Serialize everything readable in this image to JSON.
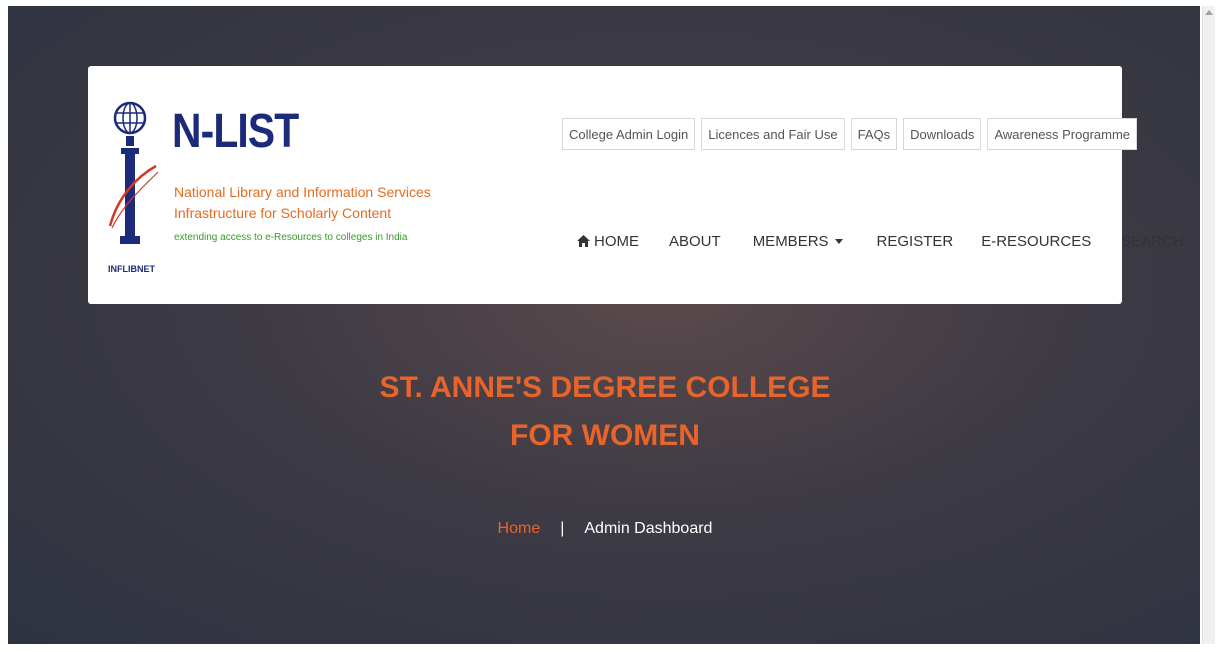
{
  "logo": {
    "title": "N-LIST",
    "line1": "National Library and Information Services",
    "line2": "Infrastructure for Scholarly Content",
    "tagline": "extending access to e-Resources to colleges in India",
    "org": "INFLIBNET"
  },
  "top_links": [
    "College Admin Login",
    "Licences and Fair Use",
    "FAQs",
    "Downloads",
    "Awareness Programme"
  ],
  "nav": {
    "home": "HOME",
    "about": "ABOUT",
    "members": "MEMBERS",
    "register": "REGISTER",
    "eresources": "E-RESOURCES",
    "search": "SEARCH"
  },
  "hero": {
    "college_line1": "ST. ANNE'S DEGREE COLLEGE",
    "college_line2": "FOR WOMEN"
  },
  "breadcrumb": {
    "home": "Home",
    "separator": "|",
    "current": "Admin Dashboard"
  },
  "colors": {
    "accent": "#e8642a",
    "brand_blue": "#1c2a7a",
    "tagline_green": "#3a9a2b"
  }
}
